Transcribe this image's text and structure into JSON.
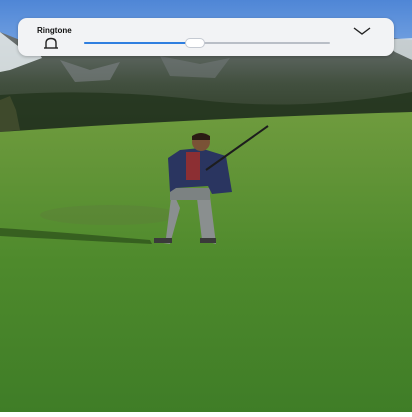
{
  "volume_panel": {
    "title": "Ringtone",
    "icon": "bell-icon",
    "expand_icon": "chevron-down-icon",
    "slider_level": 0.45,
    "accent_color": "#2f7fe0"
  }
}
